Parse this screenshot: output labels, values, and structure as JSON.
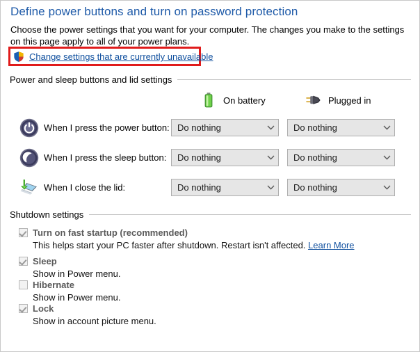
{
  "page": {
    "title": "Define power buttons and turn on password protection",
    "intro": "Choose the power settings that you want for your computer. The changes you make to the settings on this page apply to all of your power plans."
  },
  "uac": {
    "link_text": "Change settings that are currently unavailable",
    "shield_icon": "uac-shield-icon",
    "highlight_color": "#e01b1b",
    "link_color": "#0f4f9e"
  },
  "groups": {
    "power_sleep": "Power and sleep buttons and lid settings",
    "shutdown": "Shutdown settings"
  },
  "columns": [
    {
      "label": "On battery",
      "icon": "battery-icon"
    },
    {
      "label": "Plugged in",
      "icon": "power-plug-icon"
    }
  ],
  "rows": [
    {
      "icon": "power-button-icon",
      "label": "When I press the power button:",
      "on_battery": "Do nothing",
      "plugged_in": "Do nothing"
    },
    {
      "icon": "sleep-button-icon",
      "label": "When I press the sleep button:",
      "on_battery": "Do nothing",
      "plugged_in": "Do nothing"
    },
    {
      "icon": "laptop-lid-icon",
      "label": "When I close the lid:",
      "on_battery": "Do nothing",
      "plugged_in": "Do nothing"
    }
  ],
  "shutdown_options": [
    {
      "title": "Turn on fast startup (recommended)",
      "checked": true,
      "description": "This helps start your PC faster after shutdown. Restart isn't affected.",
      "link": "Learn More"
    },
    {
      "title": "Sleep",
      "checked": true,
      "description": "Show in Power menu.",
      "link": ""
    },
    {
      "title": "Hibernate",
      "checked": false,
      "description": "Show in Power menu.",
      "link": ""
    },
    {
      "title": "Lock",
      "checked": true,
      "description": "Show in account picture menu.",
      "link": ""
    }
  ]
}
